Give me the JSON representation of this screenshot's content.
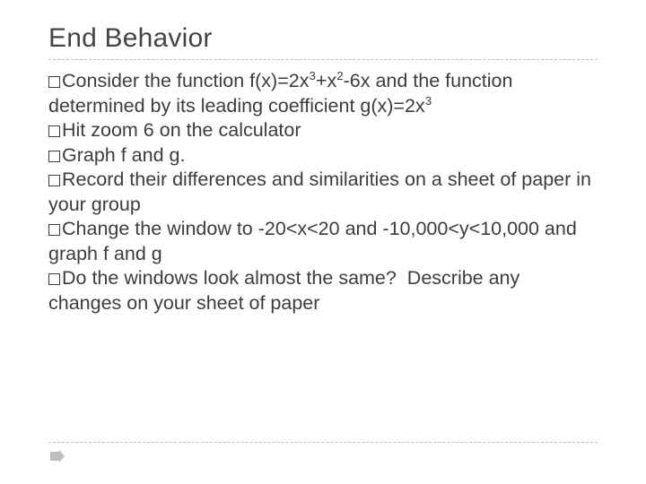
{
  "title": "End Behavior",
  "items": [
    {
      "pre": "Consider",
      "rest_html": " the function f(x)=2x<span class=\"sup\">3</span>+x<span class=\"sup\">2</span>-6x and the function determined by its leading coefficient g(x)=2x<span class=\"sup\">3</span>"
    },
    {
      "pre": "Hit",
      "rest_html": " zoom 6 on the calculator"
    },
    {
      "pre": "Graph",
      "rest_html": " f and g."
    },
    {
      "pre": "Record",
      "rest_html": " their differences and similarities on a sheet of paper in your group"
    },
    {
      "pre": "Change",
      "rest_html": " the window to -20&lt;x&lt;20 and -10,000&lt;y&lt;10,000 and graph f and g"
    },
    {
      "pre": "Do",
      "rest_html": " the windows look almost the same?&nbsp; Describe any changes on your sheet of paper"
    }
  ]
}
